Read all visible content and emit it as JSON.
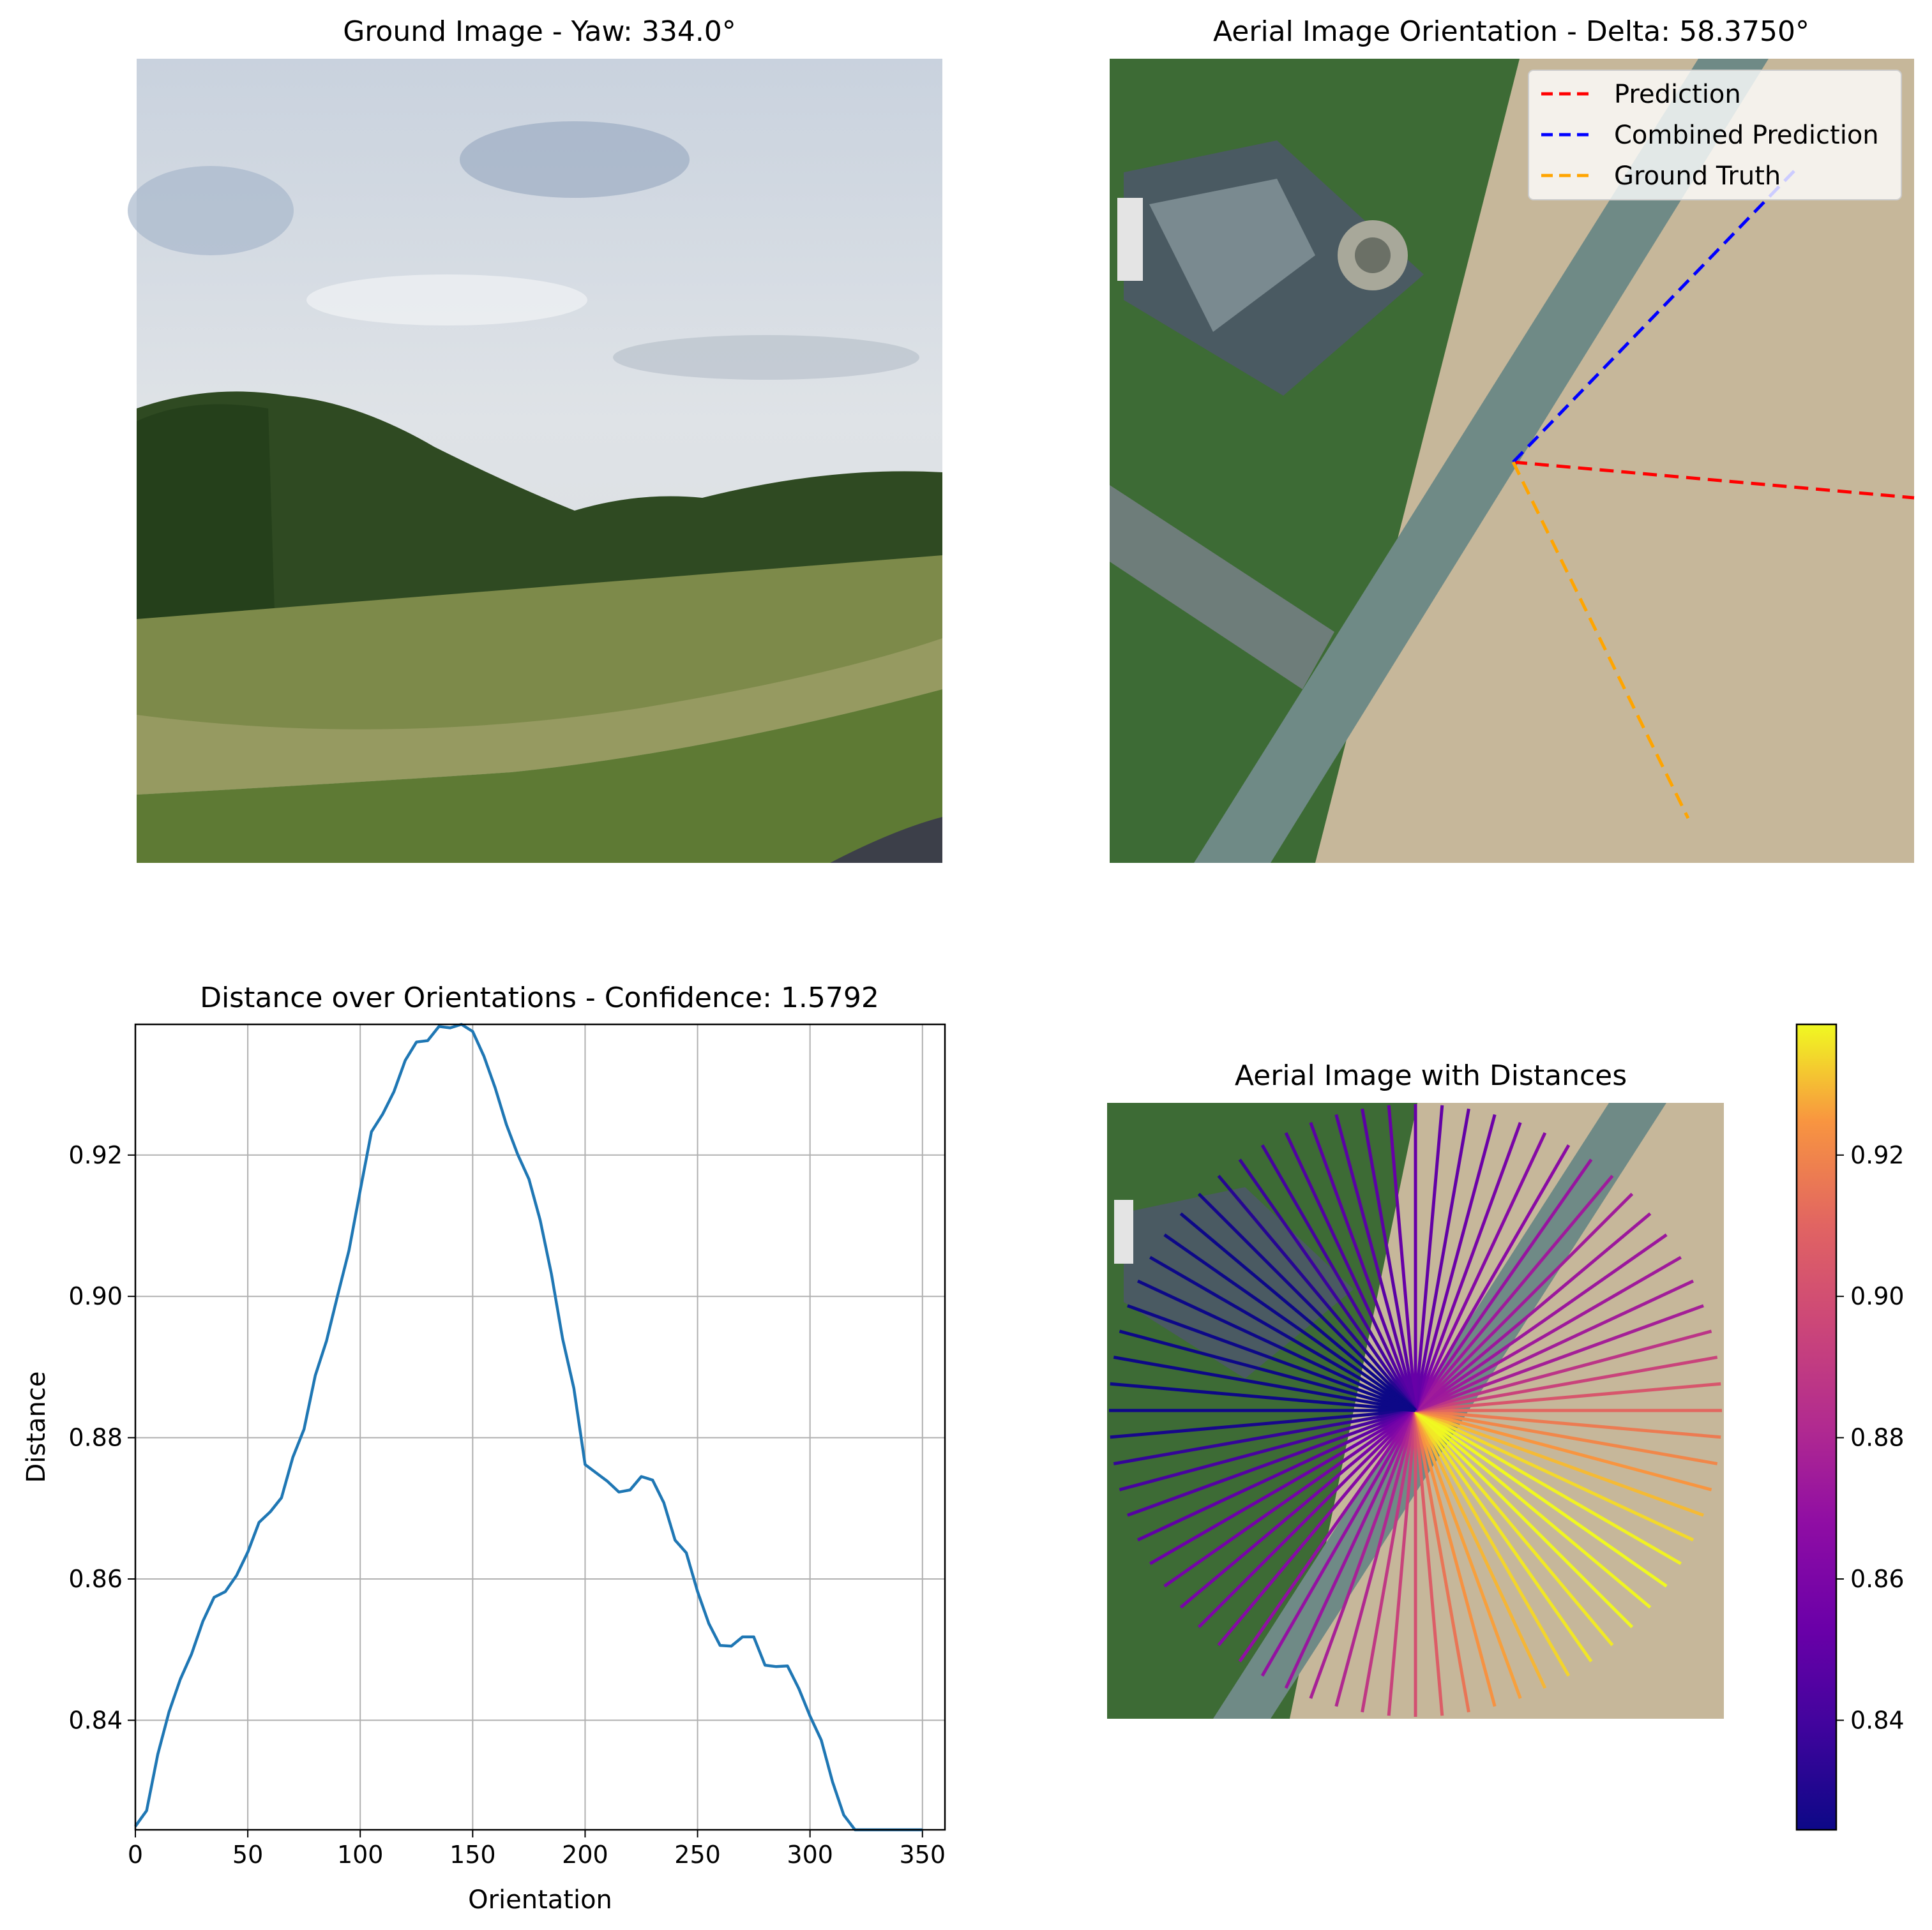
{
  "panels": {
    "ground": {
      "title": "Ground Image - Yaw: 334.0°"
    },
    "aerial": {
      "title": "Aerial Image Orientation - Delta: 58.3750°",
      "legend": [
        {
          "label": "Prediction",
          "color": "#ff0000"
        },
        {
          "label": "Combined Prediction",
          "color": "#0000ff"
        },
        {
          "label": "Ground Truth",
          "color": "#ffa500"
        }
      ]
    },
    "distances": {
      "title": "Aerial Image with Distances"
    }
  },
  "colorbar": {
    "colormap": "plasma",
    "range": [
      0.8245,
      0.9385
    ],
    "ticks": [
      0.84,
      0.86,
      0.88,
      0.9,
      0.92
    ],
    "tick_labels": [
      "0.84",
      "0.86",
      "0.88",
      "0.90",
      "0.92"
    ]
  },
  "chart_data": {
    "type": "line",
    "title": "Distance over Orientations - Confidence: 1.5792",
    "xlabel": "Orientation",
    "ylabel": "Distance",
    "xlim": [
      0,
      360
    ],
    "ylim": [
      0.8245,
      0.9385
    ],
    "grid": true,
    "line_color": "#1f77b4",
    "xticks": [
      0,
      50,
      100,
      150,
      200,
      250,
      300,
      350
    ],
    "xtick_labels": [
      "0",
      "50",
      "100",
      "150",
      "200",
      "250",
      "300",
      "350"
    ],
    "yticks": [
      0.84,
      0.86,
      0.88,
      0.9,
      0.92
    ],
    "ytick_labels": [
      "0.84",
      "0.86",
      "0.88",
      "0.90",
      "0.92"
    ],
    "x": [
      0,
      5,
      10,
      15,
      20,
      25,
      30,
      35,
      40,
      45,
      50,
      55,
      60,
      65,
      70,
      75,
      80,
      85,
      90,
      95,
      100,
      105,
      110,
      115,
      120,
      125,
      130,
      135,
      140,
      145,
      150,
      155,
      160,
      165,
      170,
      175,
      180,
      185,
      190,
      195,
      200,
      205,
      210,
      215,
      220,
      225,
      230,
      235,
      240,
      245,
      250,
      255,
      260,
      265,
      270,
      275,
      280,
      285,
      290,
      295,
      300,
      305,
      310,
      315,
      320,
      325,
      330,
      335,
      340,
      345,
      350,
      355
    ],
    "y": [
      0.825,
      0.8272,
      0.8352,
      0.8412,
      0.8458,
      0.8494,
      0.854,
      0.8574,
      0.8582,
      0.8605,
      0.8638,
      0.868,
      0.8695,
      0.8715,
      0.8772,
      0.8812,
      0.8888,
      0.8937,
      0.9002,
      0.9065,
      0.915,
      0.9233,
      0.9258,
      0.929,
      0.9334,
      0.936,
      0.9362,
      0.9382,
      0.938,
      0.9385,
      0.9375,
      0.934,
      0.9295,
      0.9243,
      0.9201,
      0.9166,
      0.9108,
      0.9032,
      0.894,
      0.887,
      0.8762,
      0.875,
      0.8738,
      0.8723,
      0.8726,
      0.8745,
      0.874,
      0.8708,
      0.8655,
      0.8637,
      0.8582,
      0.8537,
      0.8506,
      0.8505,
      0.8518,
      0.8518,
      0.8478,
      0.8476,
      0.8477,
      0.8445,
      0.8406,
      0.8372,
      0.8313,
      0.8266,
      0.8245,
      0.8245,
      0.8245,
      0.8245,
      0.8245,
      0.8245,
      0.8245,
      0.8245
    ],
    "x_points_rendered": 72
  }
}
